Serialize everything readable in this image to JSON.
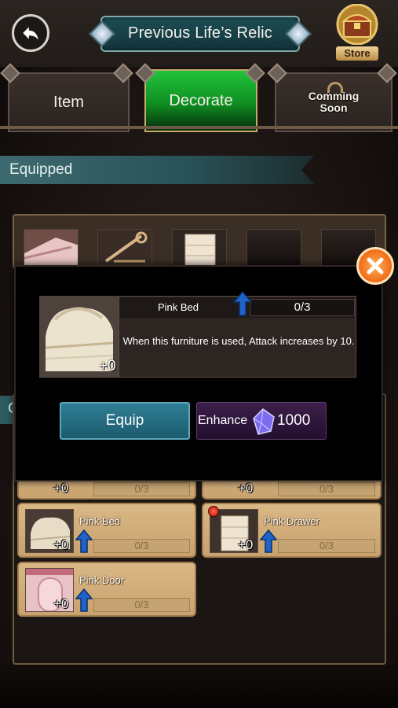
{
  "header": {
    "title": "Previous Life’s Relic",
    "store_label": "Store"
  },
  "tabs": [
    {
      "label": "Item",
      "active": false
    },
    {
      "label": "Decorate",
      "active": true
    },
    {
      "label": "Comming Soon",
      "line1": "Comming",
      "line2": "Soon",
      "active": false
    }
  ],
  "equipped": {
    "label": "Equipped",
    "slots": [
      "bed",
      "rack",
      "drawer",
      "empty",
      "empty"
    ]
  },
  "popup": {
    "item_name": "Pink Bed",
    "level": "+0",
    "progress": "0/3",
    "description": "When this furniture is used, Attack increases by 10.",
    "equip_label": "Equip",
    "enhance_label": "Enhance",
    "enhance_cost": "1000"
  },
  "list": {
    "partial_row": [
      {
        "level": "+0",
        "progress": "0/3"
      },
      {
        "level": "+0",
        "progress": "0/3"
      }
    ],
    "items": [
      {
        "name": "Pink Bed",
        "level": "+0",
        "progress": "0/3",
        "new": false
      },
      {
        "name": "Pink Drawer",
        "level": "+0",
        "progress": "0/3",
        "new": true
      },
      {
        "name": "Pink Door",
        "level": "+0",
        "progress": "0/3",
        "new": false
      }
    ]
  },
  "colors": {
    "active_tab": "#1fb535",
    "equip_button": "#2a7186",
    "enhance_button": "#32183e",
    "close_button": "#f2701a",
    "card": "#d2ae7c"
  },
  "icons": [
    "back-arrow-icon",
    "chest-icon",
    "lock-icon",
    "close-icon",
    "up-arrow-icon",
    "crystal-gem-icon"
  ]
}
